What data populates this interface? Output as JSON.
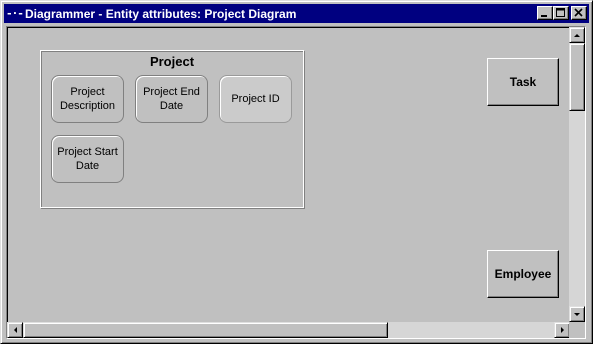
{
  "window": {
    "app_icon": "-·-",
    "title": "Diagrammer - Entity attributes: Project Diagram",
    "buttons": {
      "minimize": "minimize-icon",
      "maximize": "maximize-icon",
      "close": "close-icon"
    }
  },
  "diagram": {
    "entity": {
      "title": "Project",
      "attributes": [
        {
          "label": "Project Description",
          "selected": false
        },
        {
          "label": "Project End Date",
          "selected": false
        },
        {
          "label": "Project ID",
          "selected": true
        },
        {
          "label": "Project Start Date",
          "selected": false
        }
      ]
    },
    "other_entities": [
      {
        "label": "Task"
      },
      {
        "label": "Employee"
      }
    ]
  },
  "colors": {
    "titlebar": "#000080",
    "face": "#c0c0c0"
  }
}
